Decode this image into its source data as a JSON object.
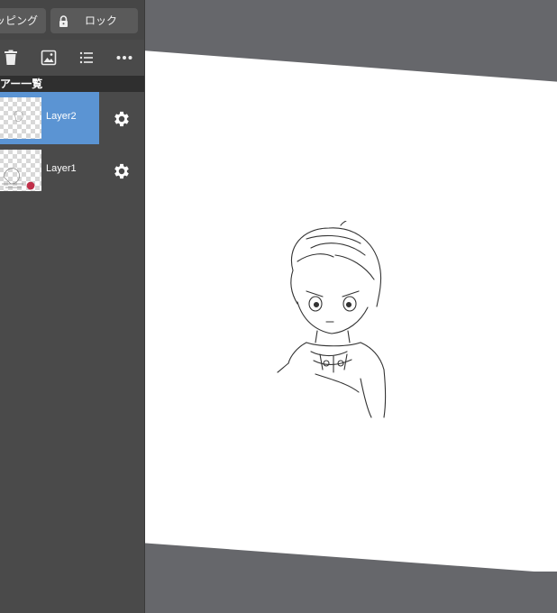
{
  "toolbar": {
    "clipping_label": "ッピング",
    "lock_label": "ロック"
  },
  "icons": {
    "lock": "lock-icon",
    "trash": "trash-icon",
    "image": "image-icon",
    "list": "list-icon",
    "more": "more-icon",
    "settings": "gear-icon"
  },
  "layer_panel": {
    "header": "アー一覧",
    "layers": [
      {
        "name": "Layer2",
        "selected": true
      },
      {
        "name": "Layer1",
        "selected": false
      }
    ]
  },
  "colors": {
    "selected_layer": "#5b94d3",
    "panel_bg": "#4a4a4a",
    "workspace_bg": "#66676b",
    "canvas": "#ffffff"
  }
}
